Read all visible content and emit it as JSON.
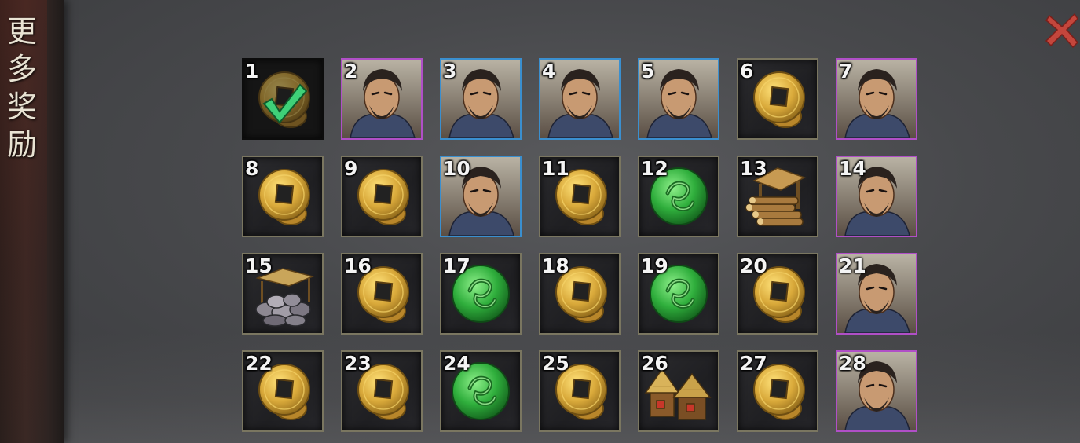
{
  "side_banner": {
    "title_chars": [
      "更",
      "多",
      "奖",
      "励"
    ]
  },
  "close_button": {
    "icon": "close-icon",
    "color": "#c4463c"
  },
  "colors": {
    "frame_default": "#7a7660",
    "frame_blue": "#3a8fcf",
    "frame_purple": "#b04fc7"
  },
  "rewards": [
    {
      "num": "1",
      "type": "coin",
      "quality": "normal",
      "claimed": true
    },
    {
      "num": "2",
      "type": "hero",
      "quality": "purple",
      "claimed": false
    },
    {
      "num": "3",
      "type": "hero",
      "quality": "blue",
      "claimed": false
    },
    {
      "num": "4",
      "type": "hero",
      "quality": "blue",
      "claimed": false
    },
    {
      "num": "5",
      "type": "hero",
      "quality": "blue",
      "claimed": false
    },
    {
      "num": "6",
      "type": "coin",
      "quality": "normal",
      "claimed": false
    },
    {
      "num": "7",
      "type": "hero",
      "quality": "purple",
      "claimed": false
    },
    {
      "num": "8",
      "type": "coin",
      "quality": "normal",
      "claimed": false
    },
    {
      "num": "9",
      "type": "coin",
      "quality": "normal",
      "claimed": false
    },
    {
      "num": "10",
      "type": "hero",
      "quality": "blue",
      "claimed": false
    },
    {
      "num": "11",
      "type": "coin",
      "quality": "normal",
      "claimed": false
    },
    {
      "num": "12",
      "type": "jade",
      "quality": "normal",
      "claimed": false
    },
    {
      "num": "13",
      "type": "lumber",
      "quality": "normal",
      "claimed": false
    },
    {
      "num": "14",
      "type": "hero",
      "quality": "purple",
      "claimed": false
    },
    {
      "num": "15",
      "type": "stone",
      "quality": "normal",
      "claimed": false
    },
    {
      "num": "16",
      "type": "coin",
      "quality": "normal",
      "claimed": false
    },
    {
      "num": "17",
      "type": "jade",
      "quality": "normal",
      "claimed": false
    },
    {
      "num": "18",
      "type": "coin",
      "quality": "normal",
      "claimed": false
    },
    {
      "num": "19",
      "type": "jade",
      "quality": "normal",
      "claimed": false
    },
    {
      "num": "20",
      "type": "coin",
      "quality": "normal",
      "claimed": false
    },
    {
      "num": "21",
      "type": "hero",
      "quality": "purple",
      "claimed": false
    },
    {
      "num": "22",
      "type": "coin",
      "quality": "normal",
      "claimed": false
    },
    {
      "num": "23",
      "type": "coin",
      "quality": "normal",
      "claimed": false
    },
    {
      "num": "24",
      "type": "jade",
      "quality": "normal",
      "claimed": false
    },
    {
      "num": "25",
      "type": "coin",
      "quality": "normal",
      "claimed": false
    },
    {
      "num": "26",
      "type": "grain",
      "quality": "normal",
      "claimed": false
    },
    {
      "num": "27",
      "type": "coin",
      "quality": "normal",
      "claimed": false
    },
    {
      "num": "28",
      "type": "hero",
      "quality": "purple",
      "claimed": false
    }
  ]
}
